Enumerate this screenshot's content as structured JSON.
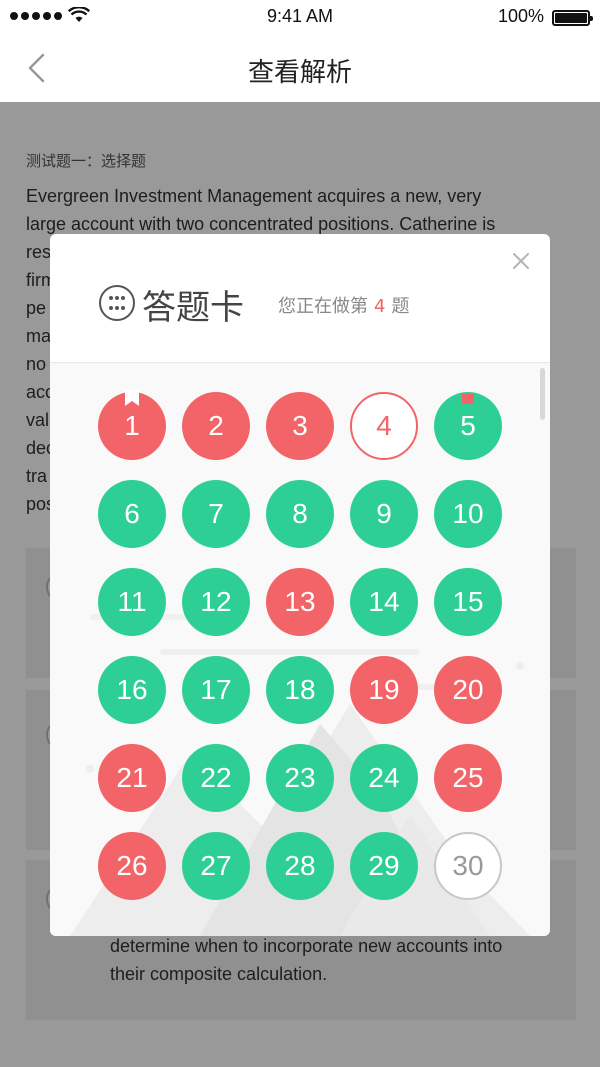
{
  "status_bar": {
    "time": "9:41 AM",
    "battery": "100%"
  },
  "nav": {
    "title": "查看解析"
  },
  "question": {
    "type_label": "测试题一：选择题",
    "text": "Evergreen Investment Management acquires a new, very large account with two concentrated positions. Catherine is res… The firm… of pe… of ma… ne no… ew acc… he val… ne dec… of tra… he pos…",
    "visible_text_lines": [
      "Evergreen Investment Management acquires a new, very",
      "large account with two concentrated positions. Catherine is",
      "res",
      "firm",
      "pe",
      "ma",
      "no",
      "acc",
      "val",
      "dec",
      "tra",
      "pos"
    ],
    "option_c_text": "determine when to incorporate new accounts into their composite calculation."
  },
  "card": {
    "title": "答题卡",
    "progress_prefix": "您正在做第",
    "progress_current": "4",
    "progress_suffix": "题",
    "colors": {
      "wrong": "#f26467",
      "correct": "#2ecf95",
      "unanswered": "#c8c8c8"
    },
    "items": [
      {
        "n": "1",
        "status": "wrong",
        "mark": "bookmark"
      },
      {
        "n": "2",
        "status": "wrong"
      },
      {
        "n": "3",
        "status": "wrong"
      },
      {
        "n": "4",
        "status": "current"
      },
      {
        "n": "5",
        "status": "correct",
        "mark": "flag"
      },
      {
        "n": "6",
        "status": "correct"
      },
      {
        "n": "7",
        "status": "correct"
      },
      {
        "n": "8",
        "status": "correct"
      },
      {
        "n": "9",
        "status": "correct"
      },
      {
        "n": "10",
        "status": "correct"
      },
      {
        "n": "11",
        "status": "correct"
      },
      {
        "n": "12",
        "status": "correct"
      },
      {
        "n": "13",
        "status": "wrong"
      },
      {
        "n": "14",
        "status": "correct"
      },
      {
        "n": "15",
        "status": "correct"
      },
      {
        "n": "16",
        "status": "correct"
      },
      {
        "n": "17",
        "status": "correct"
      },
      {
        "n": "18",
        "status": "correct"
      },
      {
        "n": "19",
        "status": "wrong"
      },
      {
        "n": "20",
        "status": "wrong"
      },
      {
        "n": "21",
        "status": "wrong"
      },
      {
        "n": "22",
        "status": "correct"
      },
      {
        "n": "23",
        "status": "correct"
      },
      {
        "n": "24",
        "status": "correct"
      },
      {
        "n": "25",
        "status": "wrong"
      },
      {
        "n": "26",
        "status": "wrong"
      },
      {
        "n": "27",
        "status": "correct"
      },
      {
        "n": "28",
        "status": "correct"
      },
      {
        "n": "29",
        "status": "correct"
      },
      {
        "n": "30",
        "status": "unanswered"
      }
    ]
  }
}
